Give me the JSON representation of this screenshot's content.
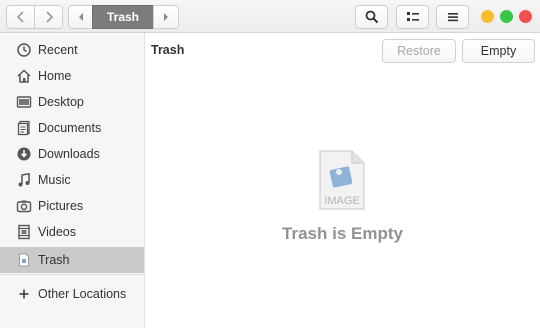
{
  "header": {
    "path_current": "Trash"
  },
  "sidebar": {
    "items": [
      {
        "label": "Recent",
        "icon": "clock-icon"
      },
      {
        "label": "Home",
        "icon": "home-icon"
      },
      {
        "label": "Desktop",
        "icon": "desktop-icon"
      },
      {
        "label": "Documents",
        "icon": "documents-icon"
      },
      {
        "label": "Downloads",
        "icon": "download-icon"
      },
      {
        "label": "Music",
        "icon": "music-note-icon"
      },
      {
        "label": "Pictures",
        "icon": "camera-icon"
      },
      {
        "label": "Videos",
        "icon": "film-icon"
      },
      {
        "label": "Trash",
        "icon": "trash-icon",
        "active": true
      }
    ],
    "other_locations": "Other Locations"
  },
  "main": {
    "location_title": "Trash",
    "restore_label": "Restore",
    "empty_label": "Empty",
    "placeholder_text": "IMAGE",
    "empty_message": "Trash is Empty"
  },
  "colors": {
    "close": "#f0514a",
    "minimize": "#f6be2f",
    "maximize": "#37c84a",
    "path_active": "#7c7c7c",
    "sidebar_selected": "#c9c9c9"
  }
}
